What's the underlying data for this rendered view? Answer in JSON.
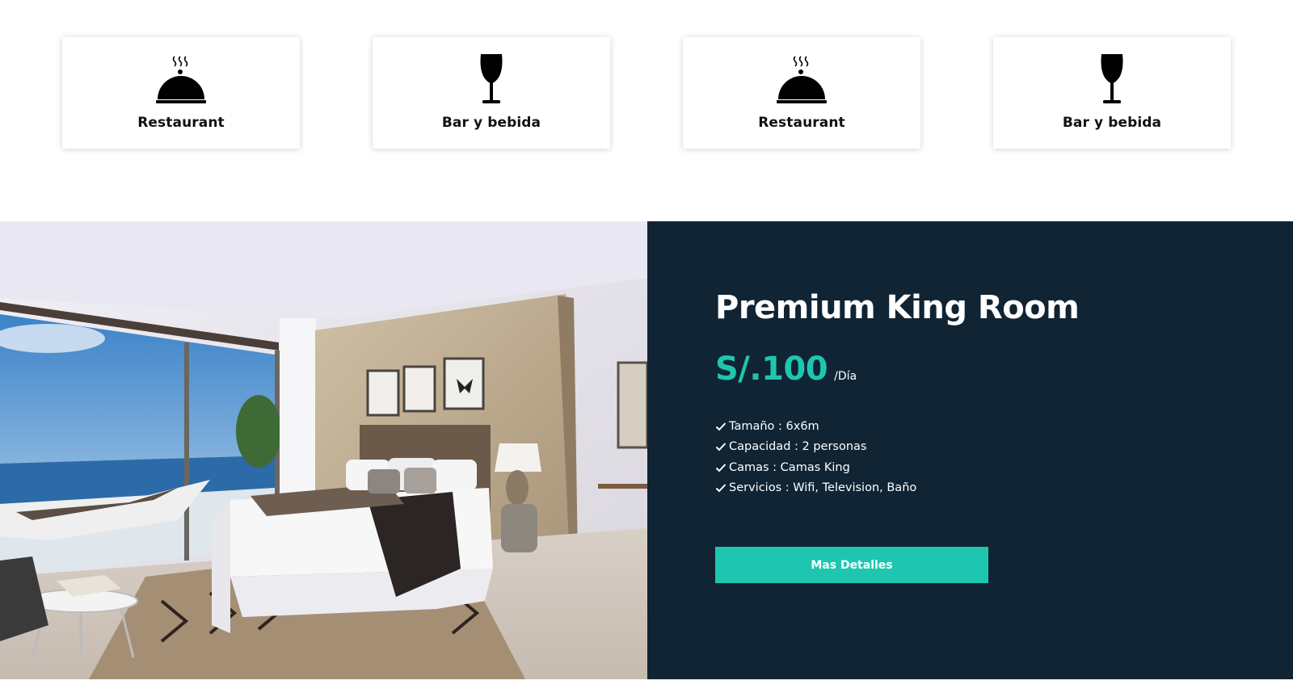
{
  "services": [
    {
      "label": "Restaurant",
      "icon": "cloche-icon"
    },
    {
      "label": "Bar y bebida",
      "icon": "wine-glass-icon"
    },
    {
      "label": "Restaurant",
      "icon": "cloche-icon"
    },
    {
      "label": "Bar y bebida",
      "icon": "wine-glass-icon"
    }
  ],
  "room": {
    "title": "Premium King Room",
    "price": "S/.100",
    "per": "/Día",
    "features": [
      "Tamaño : 6x6m",
      "Capacidad : 2 personas",
      "Camas : Camas King",
      "Servicios : Wifi, Television, Baño"
    ],
    "button_label": "Mas Detalles",
    "photo_description_icon": "bedroom-photo"
  },
  "colors": {
    "panel_bg": "#102434",
    "accent": "#1ec6b0",
    "card_bg": "#ffffff"
  }
}
